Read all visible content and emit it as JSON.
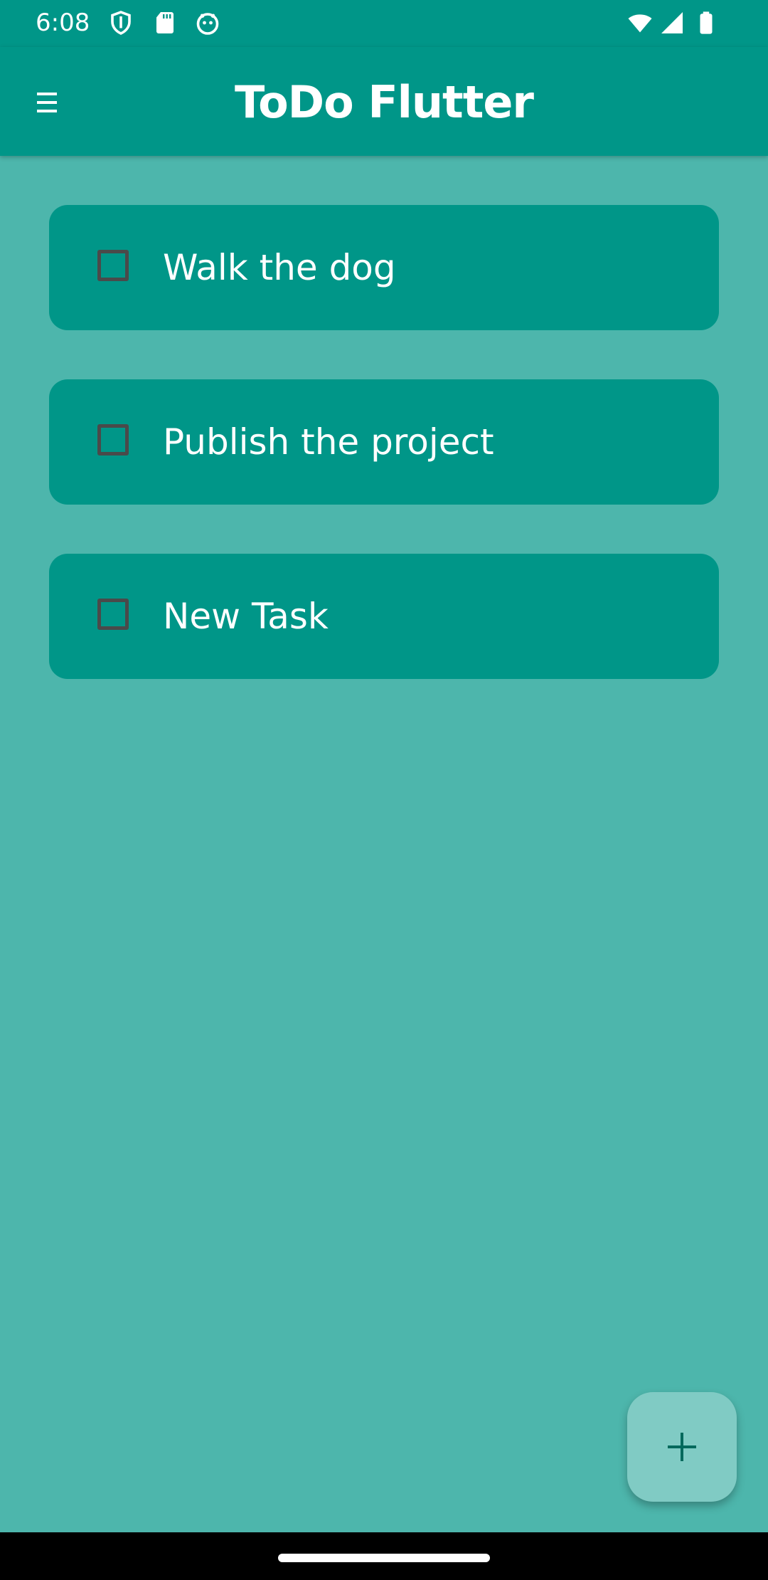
{
  "status_bar": {
    "time": "6:08",
    "icons": [
      "shield-icon",
      "sd-card-icon",
      "robot-face-icon",
      "wifi-icon",
      "cellular-signal-icon",
      "battery-icon"
    ]
  },
  "app_bar": {
    "title": "ToDo Flutter",
    "menu_icon": "hamburger-menu-icon"
  },
  "tasks": [
    {
      "label": "Walk the dog",
      "checked": false
    },
    {
      "label": "Publish the project",
      "checked": false
    },
    {
      "label": "New Task",
      "checked": false
    }
  ],
  "fab": {
    "icon": "plus-icon"
  },
  "colors": {
    "primary": "#009688",
    "background": "#4db6ac",
    "fab": "#80cbc4",
    "checkbox_border": "#4a4a4a",
    "fab_icon": "#00695c"
  }
}
